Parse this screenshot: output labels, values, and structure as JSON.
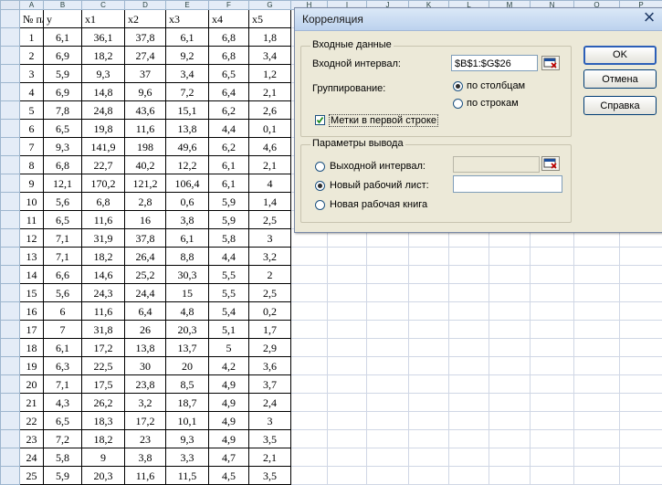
{
  "columns": [
    "A",
    "B",
    "C",
    "D",
    "E",
    "F",
    "G",
    "H",
    "I",
    "J",
    "K",
    "L",
    "M",
    "N",
    "O",
    "P"
  ],
  "table": {
    "headers": [
      "№ п/п",
      "y",
      "x1",
      "x2",
      "x3",
      "x4",
      "x5"
    ],
    "rows": [
      [
        "1",
        "6,1",
        "36,1",
        "37,8",
        "6,1",
        "6,8",
        "1,8"
      ],
      [
        "2",
        "6,9",
        "18,2",
        "27,4",
        "9,2",
        "6,8",
        "3,4"
      ],
      [
        "3",
        "5,9",
        "9,3",
        "37",
        "3,4",
        "6,5",
        "1,2"
      ],
      [
        "4",
        "6,9",
        "14,8",
        "9,6",
        "7,2",
        "6,4",
        "2,1"
      ],
      [
        "5",
        "7,8",
        "24,8",
        "43,6",
        "15,1",
        "6,2",
        "2,6"
      ],
      [
        "6",
        "6,5",
        "19,8",
        "11,6",
        "13,8",
        "4,4",
        "0,1"
      ],
      [
        "7",
        "9,3",
        "141,9",
        "198",
        "49,6",
        "6,2",
        "4,6"
      ],
      [
        "8",
        "6,8",
        "22,7",
        "40,2",
        "12,2",
        "6,1",
        "2,1"
      ],
      [
        "9",
        "12,1",
        "170,2",
        "121,2",
        "106,4",
        "6,1",
        "4"
      ],
      [
        "10",
        "5,6",
        "6,8",
        "2,8",
        "0,6",
        "5,9",
        "1,4"
      ],
      [
        "11",
        "6,5",
        "11,6",
        "16",
        "3,8",
        "5,9",
        "2,5"
      ],
      [
        "12",
        "7,1",
        "31,9",
        "37,8",
        "6,1",
        "5,8",
        "3"
      ],
      [
        "13",
        "7,1",
        "18,2",
        "26,4",
        "8,8",
        "4,4",
        "3,2"
      ],
      [
        "14",
        "6,6",
        "14,6",
        "25,2",
        "30,3",
        "5,5",
        "2"
      ],
      [
        "15",
        "5,6",
        "24,3",
        "24,4",
        "15",
        "5,5",
        "2,5"
      ],
      [
        "16",
        "6",
        "11,6",
        "6,4",
        "4,8",
        "5,4",
        "0,2"
      ],
      [
        "17",
        "7",
        "31,8",
        "26",
        "20,3",
        "5,1",
        "1,7"
      ],
      [
        "18",
        "6,1",
        "17,2",
        "13,8",
        "13,7",
        "5",
        "2,9"
      ],
      [
        "19",
        "6,3",
        "22,5",
        "30",
        "20",
        "4,2",
        "3,6"
      ],
      [
        "20",
        "7,1",
        "17,5",
        "23,8",
        "8,5",
        "4,9",
        "3,7"
      ],
      [
        "21",
        "4,3",
        "26,2",
        "3,2",
        "18,7",
        "4,9",
        "2,4"
      ],
      [
        "22",
        "6,5",
        "18,3",
        "17,2",
        "10,1",
        "4,9",
        "3"
      ],
      [
        "23",
        "7,2",
        "18,2",
        "23",
        "9,3",
        "4,9",
        "3,5"
      ],
      [
        "24",
        "5,8",
        "9",
        "3,8",
        "3,3",
        "4,7",
        "2,1"
      ],
      [
        "25",
        "5,9",
        "20,3",
        "11,6",
        "11,5",
        "4,5",
        "3,5"
      ]
    ]
  },
  "dialog": {
    "title": "Корреляция",
    "input_group": {
      "title": "Входные данные",
      "range_label": "Входной интервал:",
      "range_value": "$B$1:$G$26",
      "grouping_label": "Группирование:",
      "by_columns": "по столбцам",
      "by_rows": "по строкам",
      "labels_checkbox": "Метки в первой строке",
      "grouping_selected": "by_columns",
      "labels_checked": true
    },
    "output_group": {
      "title": "Параметры вывода",
      "output_range": "Выходной интервал:",
      "new_sheet": "Новый рабочий лист:",
      "new_book": "Новая рабочая книга",
      "output_range_value": "",
      "new_sheet_value": "",
      "selected": "new_sheet"
    },
    "buttons": {
      "ok": "OK",
      "cancel": "Отмена",
      "help": "Справка"
    }
  }
}
